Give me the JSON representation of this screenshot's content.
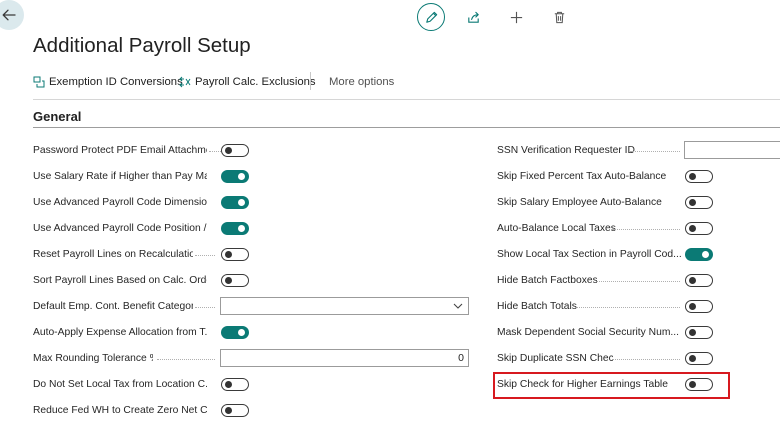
{
  "page": {
    "title": "Additional Payroll Setup"
  },
  "actions": [
    {
      "label": "Exemption ID Conversions",
      "icon": "conversion-icon"
    },
    {
      "label": "Payroll Calc. Exclusions",
      "icon": "exclusions-icon"
    }
  ],
  "more_options": "More options",
  "section": {
    "title": "General"
  },
  "left_fields": [
    {
      "label": "Password Protect PDF Email Attachme...",
      "type": "toggle",
      "on": false
    },
    {
      "label": "Use Salary Rate if Higher than Pay Ma...",
      "type": "toggle",
      "on": true
    },
    {
      "label": "Use Advanced Payroll Code Dimensions",
      "type": "toggle",
      "on": true
    },
    {
      "label": "Use Advanced Payroll Code Position / ...",
      "type": "toggle",
      "on": true
    },
    {
      "label": "Reset Payroll Lines on Recalculation",
      "type": "toggle",
      "on": false
    },
    {
      "label": "Sort Payroll Lines Based on Calc. Order",
      "type": "toggle",
      "on": false
    },
    {
      "label": "Default Emp. Cont. Benefit Category",
      "type": "select",
      "value": ""
    },
    {
      "label": "Auto-Apply Expense Allocation from T...",
      "type": "toggle",
      "on": true
    },
    {
      "label": "Max Rounding Tolerance %",
      "type": "number",
      "value": "0"
    },
    {
      "label": "Do Not Set Local Tax from Location C...",
      "type": "toggle",
      "on": false
    },
    {
      "label": "Reduce Fed WH to Create Zero Net C...",
      "type": "toggle",
      "on": false
    }
  ],
  "right_fields": [
    {
      "label": "SSN Verification Requester ID",
      "type": "text",
      "value": ""
    },
    {
      "label": "Skip Fixed Percent Tax Auto-Balance",
      "type": "toggle",
      "on": false
    },
    {
      "label": "Skip Salary Employee Auto-Balance",
      "type": "toggle",
      "on": false
    },
    {
      "label": "Auto-Balance Local Taxes",
      "type": "toggle",
      "on": false
    },
    {
      "label": "Show Local Tax Section in Payroll Cod...",
      "type": "toggle",
      "on": true
    },
    {
      "label": "Hide Batch Factboxes",
      "type": "toggle",
      "on": false
    },
    {
      "label": "Hide Batch Totals",
      "type": "toggle",
      "on": false
    },
    {
      "label": "Mask Dependent Social Security Num...",
      "type": "toggle",
      "on": false
    },
    {
      "label": "Skip Duplicate SSN Check",
      "type": "toggle",
      "on": false
    },
    {
      "label": "Skip Check for Higher Earnings Table ...",
      "type": "toggle",
      "on": false,
      "highlighted": true
    }
  ],
  "colors": {
    "accent": "#0b7a75",
    "highlight": "#d7191f",
    "back_bg": "#dbe9ed"
  }
}
